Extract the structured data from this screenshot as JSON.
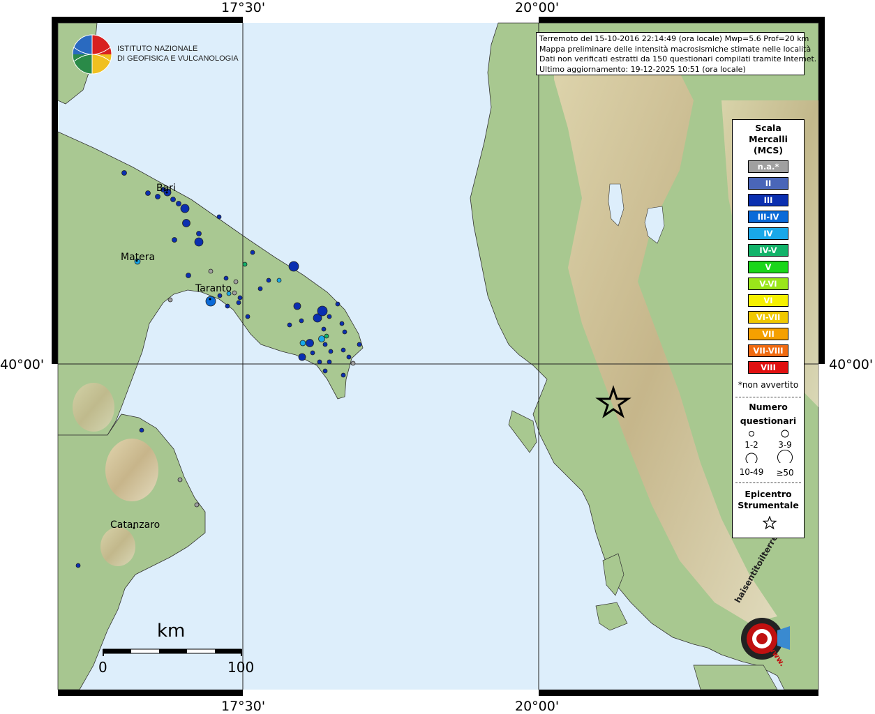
{
  "map": {
    "axis_labels": {
      "top": [
        "17°30'",
        "20°00'"
      ],
      "bottom": [
        "17°30'",
        "20°00'"
      ],
      "left": "40°00'",
      "right": "40°00'"
    },
    "logo": {
      "line1": "ISTITUTO NAZIONALE",
      "line2": "DI GEOFISICA E VULCANOLOGIA"
    },
    "info": {
      "line1": "Terremoto del 15-10-2016 22:14:49 (ora locale) Mwp=5.6 Prof=20 km",
      "line2": "Mappa preliminare delle intensità macrosismiche stimate nelle località",
      "line3": "Dati non verificati estratti da 150 questionari compilati tramite Internet.",
      "line4": "Ultimo aggiornamento: 19-12-2025 10:51 (ora locale)"
    },
    "cities": [
      "Bari",
      "Matera",
      "Taranto",
      "Catanzaro"
    ],
    "scalebar": {
      "unit": "km",
      "start": "0",
      "end": "100"
    },
    "watermark": {
      "brand": "haisentitoilterremoto.it",
      "sub": "www."
    }
  },
  "legend": {
    "title": [
      "Scala",
      "Mercalli",
      "(MCS)"
    ],
    "classes": [
      {
        "label": "n.a.*",
        "color": "#a0a0a0"
      },
      {
        "label": "II",
        "color": "#4a66b8"
      },
      {
        "label": "III",
        "color": "#0a2fb0"
      },
      {
        "label": "III-IV",
        "color": "#0a6ad8"
      },
      {
        "label": "IV",
        "color": "#19a8e8"
      },
      {
        "label": "IV-V",
        "color": "#12b36a"
      },
      {
        "label": "V",
        "color": "#1ad61a"
      },
      {
        "label": "V-VI",
        "color": "#9ae61a"
      },
      {
        "label": "VI",
        "color": "#f5f000"
      },
      {
        "label": "VI-VII",
        "color": "#f0c800"
      },
      {
        "label": "VII",
        "color": "#f5a000"
      },
      {
        "label": "VII-VIII",
        "color": "#f06a10"
      },
      {
        "label": "VIII",
        "color": "#e01010"
      }
    ],
    "note": "*non avvertito",
    "questionnaire_title": [
      "Numero",
      "questionari"
    ],
    "sizes": [
      "1-2",
      "3-9",
      "10-49",
      "≥50"
    ],
    "epicenter_title": [
      "Epicentro",
      "Strumentale"
    ]
  },
  "colors": {
    "sea": "#dcedfa",
    "land": "#a8c890",
    "highland": "#d8c8a0"
  }
}
